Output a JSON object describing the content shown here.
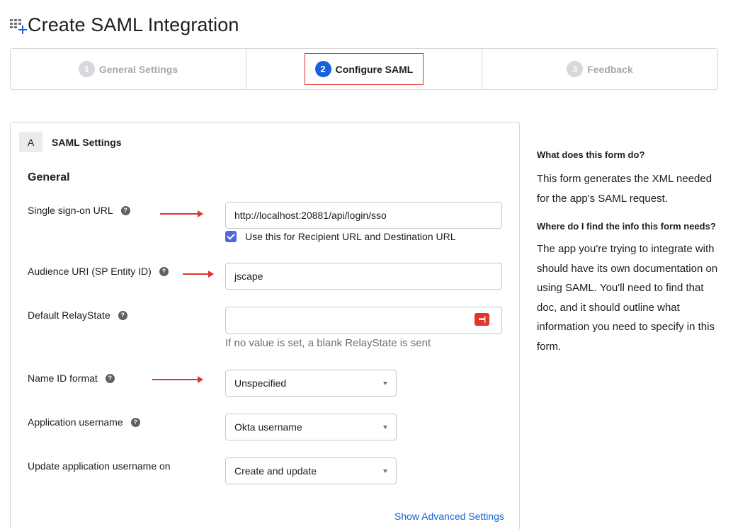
{
  "page": {
    "title": "Create SAML Integration"
  },
  "steps": [
    {
      "num": "1",
      "label": "General Settings"
    },
    {
      "num": "2",
      "label": "Configure SAML"
    },
    {
      "num": "3",
      "label": "Feedback"
    }
  ],
  "section": {
    "letter": "A",
    "title": "SAML Settings",
    "group": "General"
  },
  "fields": {
    "sso_url": {
      "label": "Single sign-on URL",
      "value": "http://localhost:20881/api/login/sso"
    },
    "recipient_checkbox": {
      "label": "Use this for Recipient URL and Destination URL",
      "checked": true
    },
    "audience_uri": {
      "label": "Audience URI (SP Entity ID)",
      "value": "jscape"
    },
    "relay_state": {
      "label": "Default RelayState",
      "value": "",
      "hint": "If no value is set, a blank RelayState is sent"
    },
    "name_id_format": {
      "label": "Name ID format",
      "selected": "Unspecified"
    },
    "app_username": {
      "label": "Application username",
      "selected": "Okta username"
    },
    "update_username_on": {
      "label": "Update application username on",
      "selected": "Create and update"
    }
  },
  "help_icon_glyph": "?",
  "password_manager_glyph": "•••|",
  "advanced_link": "Show Advanced Settings",
  "sidebar": {
    "q1": "What does this form do?",
    "a1": "This form generates the XML needed for the app's SAML request.",
    "q2": "Where do I find the info this form needs?",
    "a2": "The app you're trying to integrate with should have its own documentation on using SAML. You'll need to find that doc, and it should outline what information you need to specify in this form."
  },
  "colors": {
    "accent": "#1662dd",
    "annotation_red": "#e0342f",
    "checkbox": "#4f66e3"
  }
}
